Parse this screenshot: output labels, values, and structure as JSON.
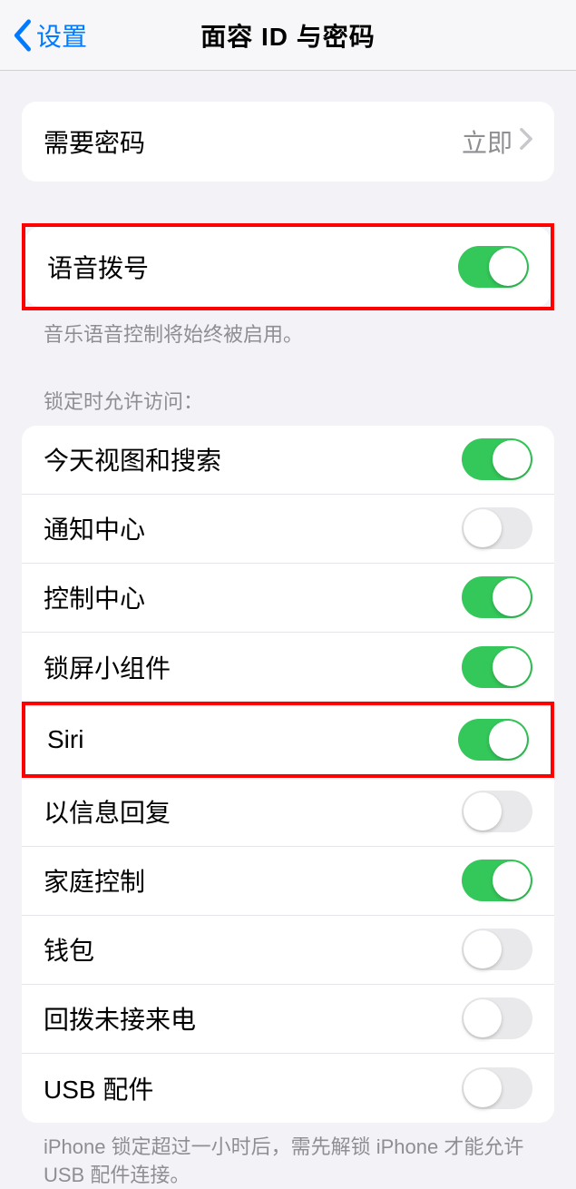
{
  "nav": {
    "back_label": "设置",
    "title": "面容 ID 与密码"
  },
  "require_passcode": {
    "label": "需要密码",
    "value": "立即"
  },
  "voice_dial": {
    "label": "语音拨号",
    "footer": "音乐语音控制将始终被启用。"
  },
  "lock_access": {
    "header": "锁定时允许访问：",
    "today": "今天视图和搜索",
    "notification": "通知中心",
    "control": "控制中心",
    "widgets": "锁屏小组件",
    "siri": "Siri",
    "reply": "以信息回复",
    "home": "家庭控制",
    "wallet": "钱包",
    "callback": "回拨未接来电",
    "usb": "USB 配件"
  },
  "usb_footer": "iPhone 锁定超过一小时后，需先解锁 iPhone 才能允许 USB 配件连接。"
}
